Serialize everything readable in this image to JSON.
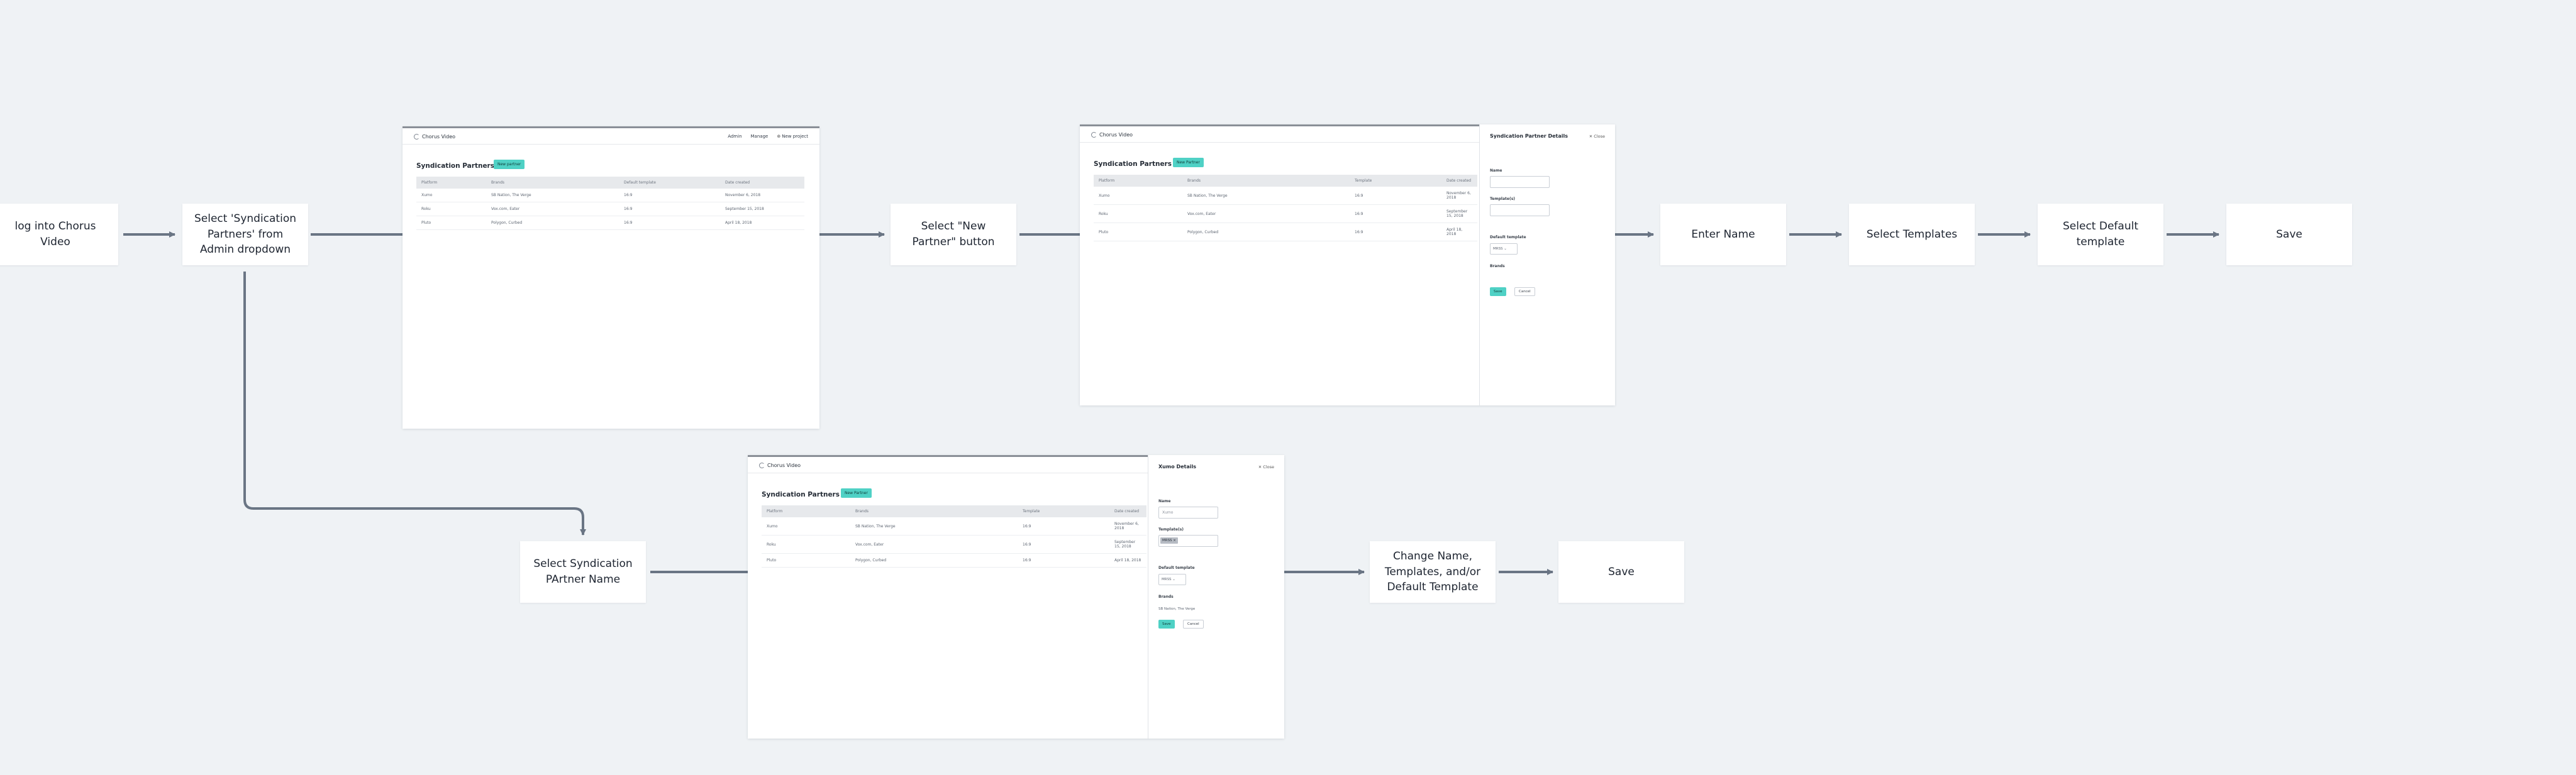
{
  "steps": {
    "login": "log into Chorus Video",
    "select_syndication": "Select 'Syndication Partners' from Admin dropdown",
    "new_partner": "Select \"New Partner\" button",
    "enter_name": "Enter Name",
    "select_templates": "Select Templates",
    "select_default": "Select Default template",
    "save_top": "Save",
    "select_partner_name": "Select Syndication PArtner Name",
    "change_fields": "Change Name, Templates, and/or Default Template",
    "save_bottom": "Save"
  },
  "screen1": {
    "brand": "Chorus Video",
    "nav": [
      "Admin",
      "Manage"
    ],
    "new_project": "New project",
    "title": "Syndication Partners",
    "new_button": "New partner",
    "columns": [
      "Platform",
      "Brands",
      "Default template",
      "Date created"
    ],
    "rows": [
      [
        "Xumo",
        "SB Nation, The Verge",
        "16:9",
        "November 6, 2018"
      ],
      [
        "Roku",
        "Vox.com, Eater",
        "16:9",
        "September 15, 2018"
      ],
      [
        "Pluto",
        "Polygon, Curbed",
        "16:9",
        "April 18, 2018"
      ]
    ]
  },
  "screen2": {
    "brand": "Chorus Video",
    "title": "Syndication Partners",
    "new_button": "New Partner",
    "columns": [
      "Platform",
      "Brands",
      "Template",
      "Date created"
    ],
    "rows": [
      [
        "Xumo",
        "SB Nation, The Verge",
        "16:9",
        "November 6, 2018"
      ],
      [
        "Roku",
        "Vox.com, Eater",
        "16:9",
        "September 15, 2018"
      ],
      [
        "Pluto",
        "Polygon, Curbed",
        "16:9",
        "April 18, 2018"
      ]
    ],
    "panel": {
      "title": "Syndication Partner Details",
      "close": "Close",
      "name_label": "Name",
      "templates_label": "Template(s)",
      "default_label": "Default template",
      "default_value": "MRSS",
      "brands_label": "Brands",
      "save": "Save",
      "cancel": "Cancel"
    }
  },
  "screen3": {
    "brand": "Chorus Video",
    "title": "Syndication Partners",
    "new_button": "New Partner",
    "columns": [
      "Platform",
      "Brands",
      "Template",
      "Date created"
    ],
    "rows": [
      [
        "Xumo",
        "SB Nation, The Verge",
        "16:9",
        "November 6, 2018"
      ],
      [
        "Roku",
        "Vox.com, Eater",
        "16:9",
        "September 15, 2018"
      ],
      [
        "Pluto",
        "Polygon, Curbed",
        "16:9",
        "April 18, 2018"
      ]
    ],
    "panel": {
      "title": "Xumo Details",
      "close": "Close",
      "name_label": "Name",
      "name_value": "Xumo",
      "templates_label": "Template(s)",
      "template_chip": "MRSS",
      "default_label": "Default template",
      "default_value": "MRSS",
      "brands_label": "Brands",
      "brands_value": "SB Nation, The Verge",
      "save": "Save",
      "cancel": "Cancel"
    }
  },
  "colors": {
    "background": "#eff2f5",
    "connector": "#6a7584",
    "accent": "#4fd1c5"
  }
}
